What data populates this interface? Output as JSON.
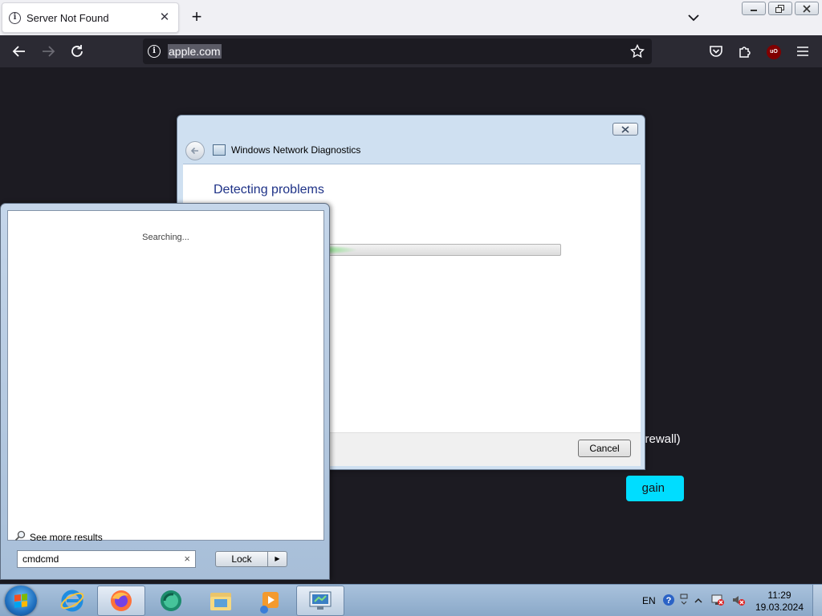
{
  "browser": {
    "tab": {
      "title": "Server Not Found",
      "close": "✕"
    },
    "new_tab": "+",
    "url": "apple.com"
  },
  "page": {
    "text_fragment": "firewall)",
    "button_fragment": "gain",
    "button_color": "#00ddff",
    "background": "#1c1b22"
  },
  "dialog": {
    "title": "Windows Network Diagnostics",
    "heading": "Detecting problems",
    "progress_indeterminate": true,
    "cancel_label": "Cancel"
  },
  "start_menu": {
    "status": "Searching...",
    "see_more": "See more results",
    "search_value": "cmdcmd",
    "clear": "×",
    "lock_label": "Lock"
  },
  "taskbar": {
    "apps": [
      "internet-explorer",
      "firefox",
      "media-app",
      "windows-explorer",
      "media-player",
      "network-diagnostics"
    ],
    "active_apps": [
      "firefox",
      "network-diagnostics"
    ],
    "language": "EN",
    "time": "11:29",
    "date": "19.03.2024"
  }
}
